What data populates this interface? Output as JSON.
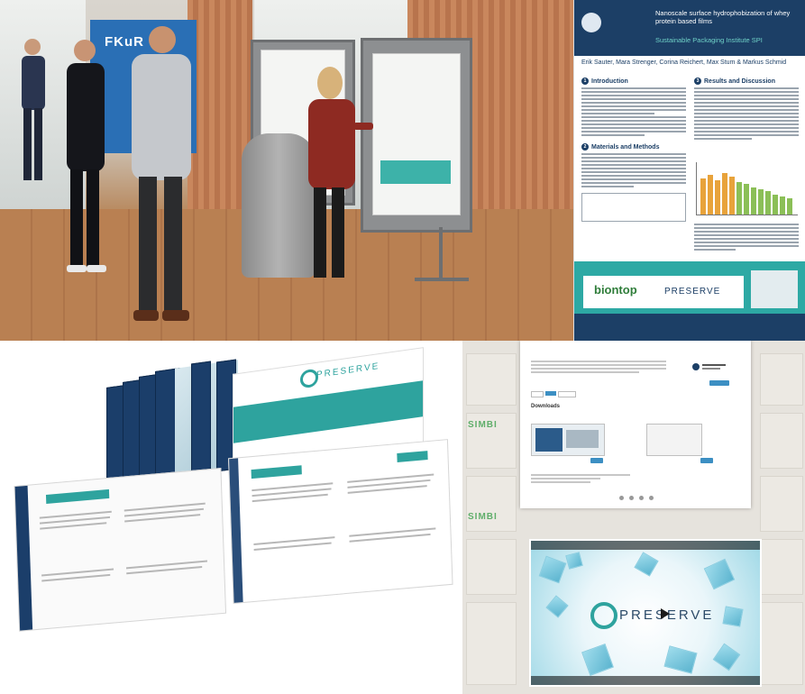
{
  "collage": {
    "poster_session": {
      "banner_logo": "FKuR"
    },
    "scientific_poster": {
      "title": "Nanoscale surface hydrophobization of whey protein based films",
      "subtitle": "Sustainable Packaging Institute SPI",
      "authors": "Erik Sauter, Mara Strenger, Corina Reichert, Max Stum & Markus Schmid",
      "sections": [
        "Introduction",
        "Results and Discussion",
        "Materials and Methods"
      ],
      "partner_logo_1": "biontop",
      "partner_logo_2": "PRESERVE"
    },
    "brochure": {
      "cover_logo": "PRESERVE"
    },
    "website": {
      "downloads_heading": "Downloads",
      "background_logo": "SIMBI",
      "video_logo": "PRESERVE"
    }
  },
  "colors": {
    "navy": "#1c3f66",
    "teal": "#2ea39e",
    "banner_blue": "#2a6fb5"
  }
}
